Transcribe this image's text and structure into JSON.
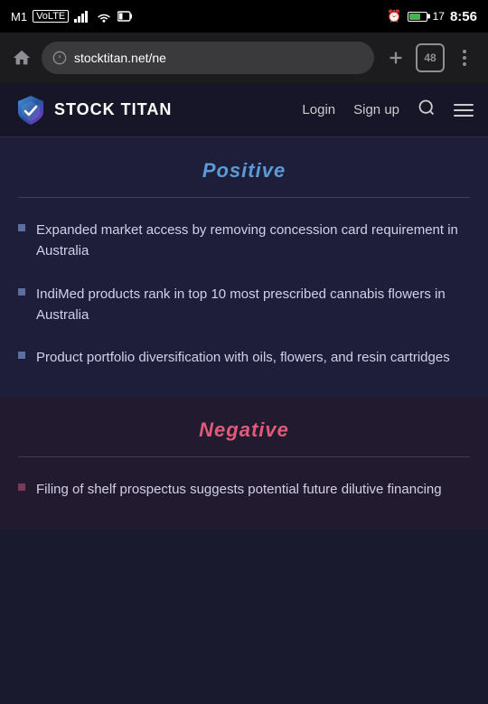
{
  "statusBar": {
    "carrier": "M1",
    "network": "VoLTE",
    "time": "8:56",
    "batteryLevel": 17,
    "alarmIcon": "⏰"
  },
  "browser": {
    "addressText": "stocktitan.net/ne",
    "tabCount": "48",
    "newTabLabel": "+",
    "menuDotsLabel": "⋮"
  },
  "navbar": {
    "brandName": "STOCK TITAN",
    "loginLabel": "Login",
    "signupLabel": "Sign up",
    "searchAriaLabel": "Search",
    "menuAriaLabel": "Menu"
  },
  "positiveSection": {
    "title": "Positive",
    "divider": true,
    "bullets": [
      {
        "text": "Expanded market access by removing concession card requirement in Australia"
      },
      {
        "text": "IndiMed products rank in top 10 most prescribed cannabis flowers in Australia"
      },
      {
        "text": "Product portfolio diversification with oils, flowers, and resin cartridges"
      }
    ]
  },
  "negativeSection": {
    "title": "Negative",
    "divider": true,
    "bullets": [
      {
        "text": "Filing of shelf prospectus suggests potential future dilutive financing"
      }
    ]
  },
  "colors": {
    "positiveTitle": "#5b9bd5",
    "negativeTitle": "#e05a7a",
    "bulletSquare": "#5b6fa0",
    "divider": "#3a3a5a"
  }
}
